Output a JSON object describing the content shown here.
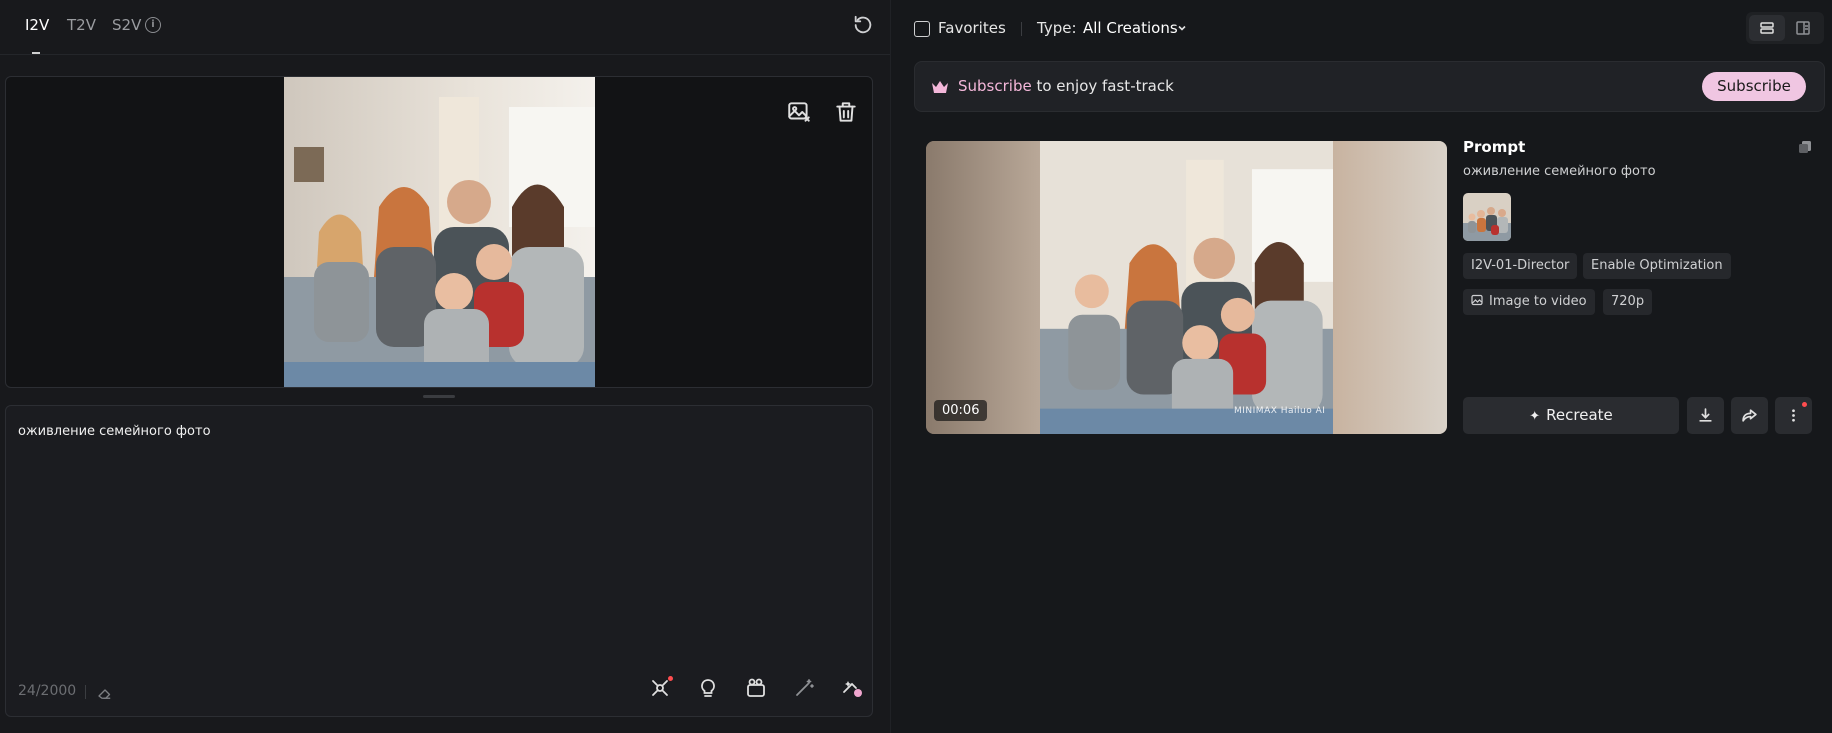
{
  "left": {
    "tabs": [
      {
        "label": "I2V",
        "active": true
      },
      {
        "label": "T2V",
        "active": false
      },
      {
        "label": "S2V",
        "active": false
      }
    ],
    "prompt": {
      "text": "оживление семейного фото",
      "counter": "24/2000"
    }
  },
  "right": {
    "favorites_label": "Favorites",
    "type_label": "Type:",
    "type_value": "All Creations",
    "banner": {
      "highlight": "Subscribe",
      "rest": " to enjoy fast-track",
      "button": "Subscribe"
    },
    "card": {
      "timestamp": "00:06",
      "watermark": "MINIMAX  Hailuo AI",
      "prompt_title": "Prompt",
      "prompt_text": "оживление семейного фото",
      "chips": [
        "I2V-01-Director",
        "Enable Optimization",
        "Image to video",
        "720p"
      ],
      "recreate_label": "Recreate"
    }
  },
  "colors": {
    "accent_pink": "#f0c6e2",
    "notification_red": "#ff4d4f"
  }
}
